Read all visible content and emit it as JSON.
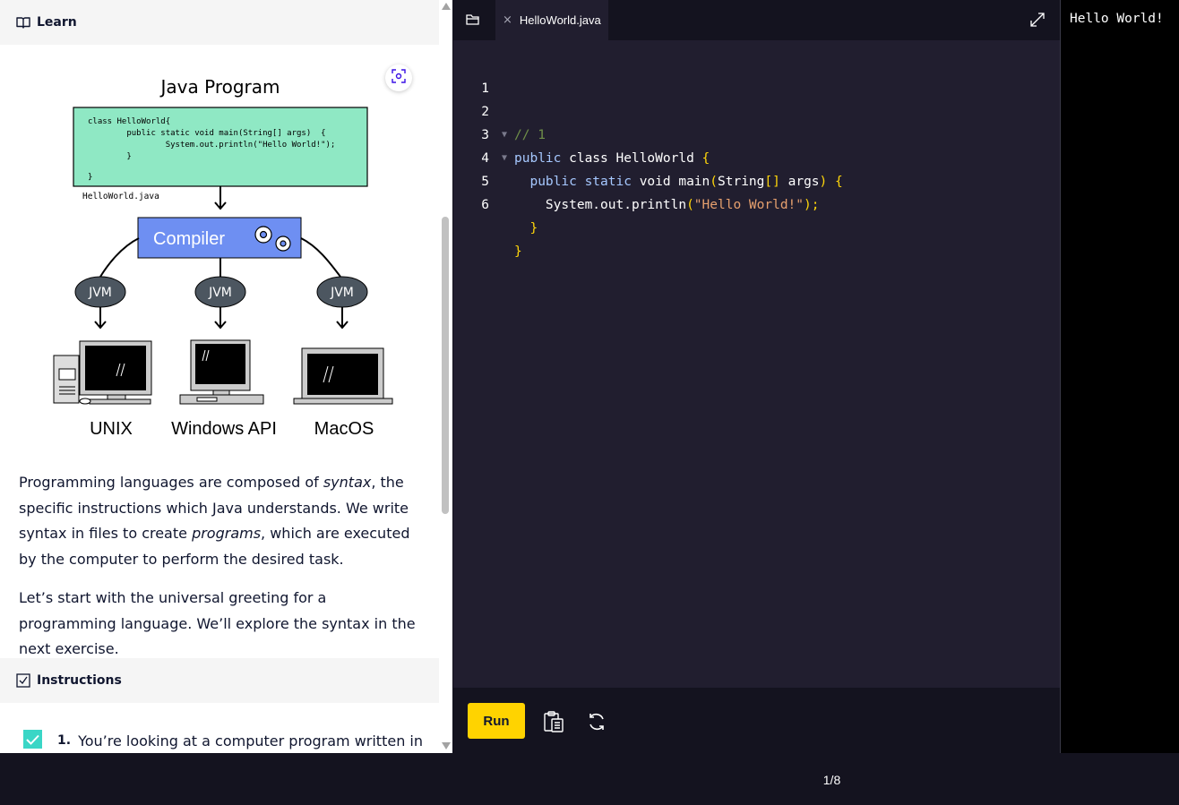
{
  "learn": {
    "header_label": "Learn",
    "diagram": {
      "title": "Java Program",
      "code_lines": [
        "class HelloWorld{",
        "        public static void main(String[] args)  {",
        "                System.out.println(\"Hello World!\");",
        "        }",
        "}"
      ],
      "file_label": "HelloWorld.java",
      "compiler_label": "Compiler",
      "jvm_labels": [
        "JVM",
        "JVM",
        "JVM"
      ],
      "platforms": [
        "UNIX",
        "Windows API",
        "MacOS"
      ]
    },
    "paragraph1": {
      "a": "Programming languages are composed of ",
      "b": "syntax",
      "c": ", the specific instructions which Java understands. We write syntax in files to create ",
      "d": "programs",
      "e": ", which are executed by the computer to perform the desired task."
    },
    "paragraph2": "Let’s start with the universal greeting for a programming language. We’ll explore the syntax in the next exercise."
  },
  "instructions": {
    "header_label": "Instructions",
    "steps": [
      {
        "number": "1.",
        "text": "You’re looking at a computer program written in",
        "checked": true
      }
    ]
  },
  "editor": {
    "tab_name": "HelloWorld.java",
    "tab_close": "×",
    "lines": [
      {
        "num": "1",
        "fold": ""
      },
      {
        "num": "2",
        "fold": "▼"
      },
      {
        "num": "3",
        "fold": "▼"
      },
      {
        "num": "4",
        "fold": ""
      },
      {
        "num": "5",
        "fold": ""
      },
      {
        "num": "6",
        "fold": ""
      }
    ],
    "tokens": {
      "l1": "// 1",
      "l2_kw": "public",
      "l2_rest": " class HelloWorld ",
      "l2_brace": "{",
      "l3_indent": "  ",
      "l3_kw": "public static",
      "l3_rest1": " void main",
      "l3_paren_open": "(",
      "l3_type": "String",
      "l3_brackets": "[]",
      "l3_args": " args",
      "l3_paren_close": ")",
      "l3_brace": " {",
      "l4_indent": "    ",
      "l4_rest": "System.out.println",
      "l4_paren_open": "(",
      "l4_str": "\"Hello World!\"",
      "l4_paren_close": ");",
      "l5": "  }",
      "l6": "}"
    },
    "run_label": "Run"
  },
  "output": {
    "text": "Hello World!"
  },
  "footer": {
    "progress": "1/8"
  },
  "colors": {
    "accent_yellow": "#ffd300",
    "check_teal": "#3ad6c6",
    "code_box_green": "#8fe8c4",
    "compiler_blue": "#6e8ff2",
    "jvm_gray": "#4c5660"
  },
  "icons": [
    "book-icon",
    "expand-image-icon",
    "checkbox-icon",
    "folder-icon",
    "close-icon",
    "fullscreen-icon",
    "clipboard-icon",
    "refresh-icon"
  ]
}
